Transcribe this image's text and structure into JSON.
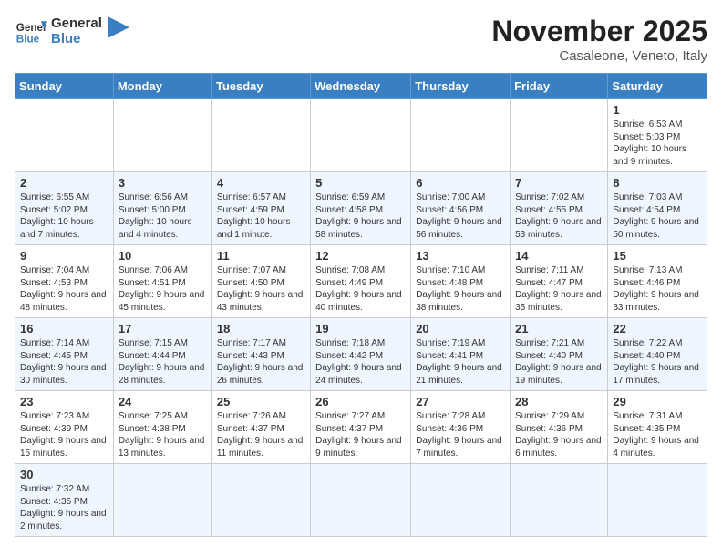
{
  "header": {
    "logo_general": "General",
    "logo_blue": "Blue",
    "title": "November 2025",
    "subtitle": "Casaleone, Veneto, Italy"
  },
  "weekdays": [
    "Sunday",
    "Monday",
    "Tuesday",
    "Wednesday",
    "Thursday",
    "Friday",
    "Saturday"
  ],
  "weeks": [
    [
      {
        "day": "",
        "info": ""
      },
      {
        "day": "",
        "info": ""
      },
      {
        "day": "",
        "info": ""
      },
      {
        "day": "",
        "info": ""
      },
      {
        "day": "",
        "info": ""
      },
      {
        "day": "",
        "info": ""
      },
      {
        "day": "1",
        "info": "Sunrise: 6:53 AM\nSunset: 5:03 PM\nDaylight: 10 hours and 9 minutes."
      }
    ],
    [
      {
        "day": "2",
        "info": "Sunrise: 6:55 AM\nSunset: 5:02 PM\nDaylight: 10 hours and 7 minutes."
      },
      {
        "day": "3",
        "info": "Sunrise: 6:56 AM\nSunset: 5:00 PM\nDaylight: 10 hours and 4 minutes."
      },
      {
        "day": "4",
        "info": "Sunrise: 6:57 AM\nSunset: 4:59 PM\nDaylight: 10 hours and 1 minute."
      },
      {
        "day": "5",
        "info": "Sunrise: 6:59 AM\nSunset: 4:58 PM\nDaylight: 9 hours and 58 minutes."
      },
      {
        "day": "6",
        "info": "Sunrise: 7:00 AM\nSunset: 4:56 PM\nDaylight: 9 hours and 56 minutes."
      },
      {
        "day": "7",
        "info": "Sunrise: 7:02 AM\nSunset: 4:55 PM\nDaylight: 9 hours and 53 minutes."
      },
      {
        "day": "8",
        "info": "Sunrise: 7:03 AM\nSunset: 4:54 PM\nDaylight: 9 hours and 50 minutes."
      }
    ],
    [
      {
        "day": "9",
        "info": "Sunrise: 7:04 AM\nSunset: 4:53 PM\nDaylight: 9 hours and 48 minutes."
      },
      {
        "day": "10",
        "info": "Sunrise: 7:06 AM\nSunset: 4:51 PM\nDaylight: 9 hours and 45 minutes."
      },
      {
        "day": "11",
        "info": "Sunrise: 7:07 AM\nSunset: 4:50 PM\nDaylight: 9 hours and 43 minutes."
      },
      {
        "day": "12",
        "info": "Sunrise: 7:08 AM\nSunset: 4:49 PM\nDaylight: 9 hours and 40 minutes."
      },
      {
        "day": "13",
        "info": "Sunrise: 7:10 AM\nSunset: 4:48 PM\nDaylight: 9 hours and 38 minutes."
      },
      {
        "day": "14",
        "info": "Sunrise: 7:11 AM\nSunset: 4:47 PM\nDaylight: 9 hours and 35 minutes."
      },
      {
        "day": "15",
        "info": "Sunrise: 7:13 AM\nSunset: 4:46 PM\nDaylight: 9 hours and 33 minutes."
      }
    ],
    [
      {
        "day": "16",
        "info": "Sunrise: 7:14 AM\nSunset: 4:45 PM\nDaylight: 9 hours and 30 minutes."
      },
      {
        "day": "17",
        "info": "Sunrise: 7:15 AM\nSunset: 4:44 PM\nDaylight: 9 hours and 28 minutes."
      },
      {
        "day": "18",
        "info": "Sunrise: 7:17 AM\nSunset: 4:43 PM\nDaylight: 9 hours and 26 minutes."
      },
      {
        "day": "19",
        "info": "Sunrise: 7:18 AM\nSunset: 4:42 PM\nDaylight: 9 hours and 24 minutes."
      },
      {
        "day": "20",
        "info": "Sunrise: 7:19 AM\nSunset: 4:41 PM\nDaylight: 9 hours and 21 minutes."
      },
      {
        "day": "21",
        "info": "Sunrise: 7:21 AM\nSunset: 4:40 PM\nDaylight: 9 hours and 19 minutes."
      },
      {
        "day": "22",
        "info": "Sunrise: 7:22 AM\nSunset: 4:40 PM\nDaylight: 9 hours and 17 minutes."
      }
    ],
    [
      {
        "day": "23",
        "info": "Sunrise: 7:23 AM\nSunset: 4:39 PM\nDaylight: 9 hours and 15 minutes."
      },
      {
        "day": "24",
        "info": "Sunrise: 7:25 AM\nSunset: 4:38 PM\nDaylight: 9 hours and 13 minutes."
      },
      {
        "day": "25",
        "info": "Sunrise: 7:26 AM\nSunset: 4:37 PM\nDaylight: 9 hours and 11 minutes."
      },
      {
        "day": "26",
        "info": "Sunrise: 7:27 AM\nSunset: 4:37 PM\nDaylight: 9 hours and 9 minutes."
      },
      {
        "day": "27",
        "info": "Sunrise: 7:28 AM\nSunset: 4:36 PM\nDaylight: 9 hours and 7 minutes."
      },
      {
        "day": "28",
        "info": "Sunrise: 7:29 AM\nSunset: 4:36 PM\nDaylight: 9 hours and 6 minutes."
      },
      {
        "day": "29",
        "info": "Sunrise: 7:31 AM\nSunset: 4:35 PM\nDaylight: 9 hours and 4 minutes."
      }
    ],
    [
      {
        "day": "30",
        "info": "Sunrise: 7:32 AM\nSunset: 4:35 PM\nDaylight: 9 hours and 2 minutes."
      },
      {
        "day": "",
        "info": ""
      },
      {
        "day": "",
        "info": ""
      },
      {
        "day": "",
        "info": ""
      },
      {
        "day": "",
        "info": ""
      },
      {
        "day": "",
        "info": ""
      },
      {
        "day": "",
        "info": ""
      }
    ]
  ]
}
